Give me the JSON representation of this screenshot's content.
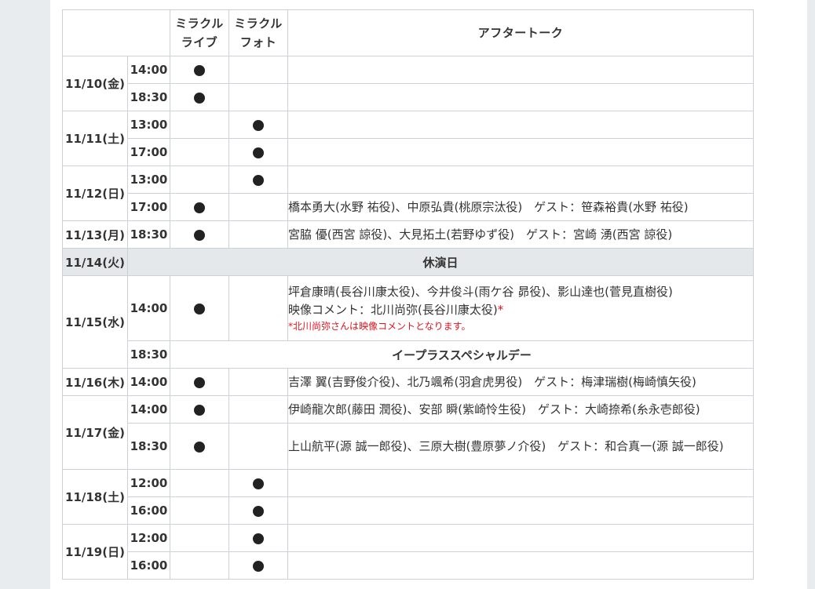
{
  "header": {
    "live": "ミラクル\nライブ",
    "live_l1": "ミラクル",
    "live_l2": "ライブ",
    "photo_l1": "ミラクル",
    "photo_l2": "フォト",
    "talk": "アフタートーク"
  },
  "days": [
    {
      "date": "11/10(金)",
      "slots": [
        {
          "time": "14:00",
          "live": true,
          "photo": false,
          "talk": ""
        },
        {
          "time": "18:30",
          "live": true,
          "photo": false,
          "talk": ""
        }
      ]
    },
    {
      "date": "11/11(土)",
      "slots": [
        {
          "time": "13:00",
          "live": false,
          "photo": true,
          "talk": ""
        },
        {
          "time": "17:00",
          "live": false,
          "photo": true,
          "talk": ""
        }
      ]
    },
    {
      "date": "11/12(日)",
      "slots": [
        {
          "time": "13:00",
          "live": false,
          "photo": true,
          "talk": ""
        },
        {
          "time": "17:00",
          "live": true,
          "photo": false,
          "talk": "橋本勇大(水野 祐役)、中原弘貴(桃原宗汰役)　ゲスト：笹森裕貴(水野 祐役)"
        }
      ]
    },
    {
      "date": "11/13(月)",
      "slots": [
        {
          "time": "18:30",
          "live": true,
          "photo": false,
          "talk": "宮脇 優(西宮 諒役)、大見拓土(若野ゆず役)　ゲスト：宮崎 湧(西宮 諒役)"
        }
      ]
    },
    {
      "date": "11/14(火)",
      "closed": "休演日"
    },
    {
      "date": "11/15(水)",
      "slots": [
        {
          "time": "14:00",
          "live": true,
          "photo": false,
          "talk_l1": "坪倉康晴(長谷川康太役)、今井俊斗(雨ケ谷 昴役)、影山達也(菅見直樹役)",
          "talk_l2": "映像コメント：北川尚弥(長谷川康太役)",
          "talk_star": "*",
          "talk_note": "*北川尚弥さんは映像コメントとなります。"
        },
        {
          "time": "18:30",
          "special": "イープラススペシャルデー"
        }
      ]
    },
    {
      "date": "11/16(木)",
      "slots": [
        {
          "time": "14:00",
          "live": true,
          "photo": false,
          "talk": "吉澤 翼(吉野俊介役)、北乃颯希(羽倉虎男役)　ゲスト：梅津瑞樹(梅崎慎矢役)"
        }
      ]
    },
    {
      "date": "11/17(金)",
      "slots": [
        {
          "time": "14:00",
          "live": true,
          "photo": false,
          "talk": "伊崎龍次郎(藤田 潤役)、安部 瞬(紫崎怜生役)　ゲスト：大崎捺希(糸永壱郎役)"
        },
        {
          "time": "18:30",
          "live": true,
          "photo": false,
          "talk": "上山航平(源 誠一郎役)、三原大樹(豊原夢ノ介役)　ゲスト：和合真一(源 誠一郎役)"
        }
      ]
    },
    {
      "date": "11/18(土)",
      "slots": [
        {
          "time": "12:00",
          "live": false,
          "photo": true,
          "talk": ""
        },
        {
          "time": "16:00",
          "live": false,
          "photo": true,
          "talk": ""
        }
      ]
    },
    {
      "date": "11/19(日)",
      "slots": [
        {
          "time": "12:00",
          "live": false,
          "photo": true,
          "talk": ""
        },
        {
          "time": "16:00",
          "live": false,
          "photo": true,
          "talk": ""
        }
      ]
    }
  ],
  "icons": {
    "mark": "filled-circle"
  },
  "colors": {
    "background": "#e8ecef",
    "border": "#ccd1d5",
    "closed_row": "#e5e8eb",
    "note_red": "#e0141e"
  }
}
